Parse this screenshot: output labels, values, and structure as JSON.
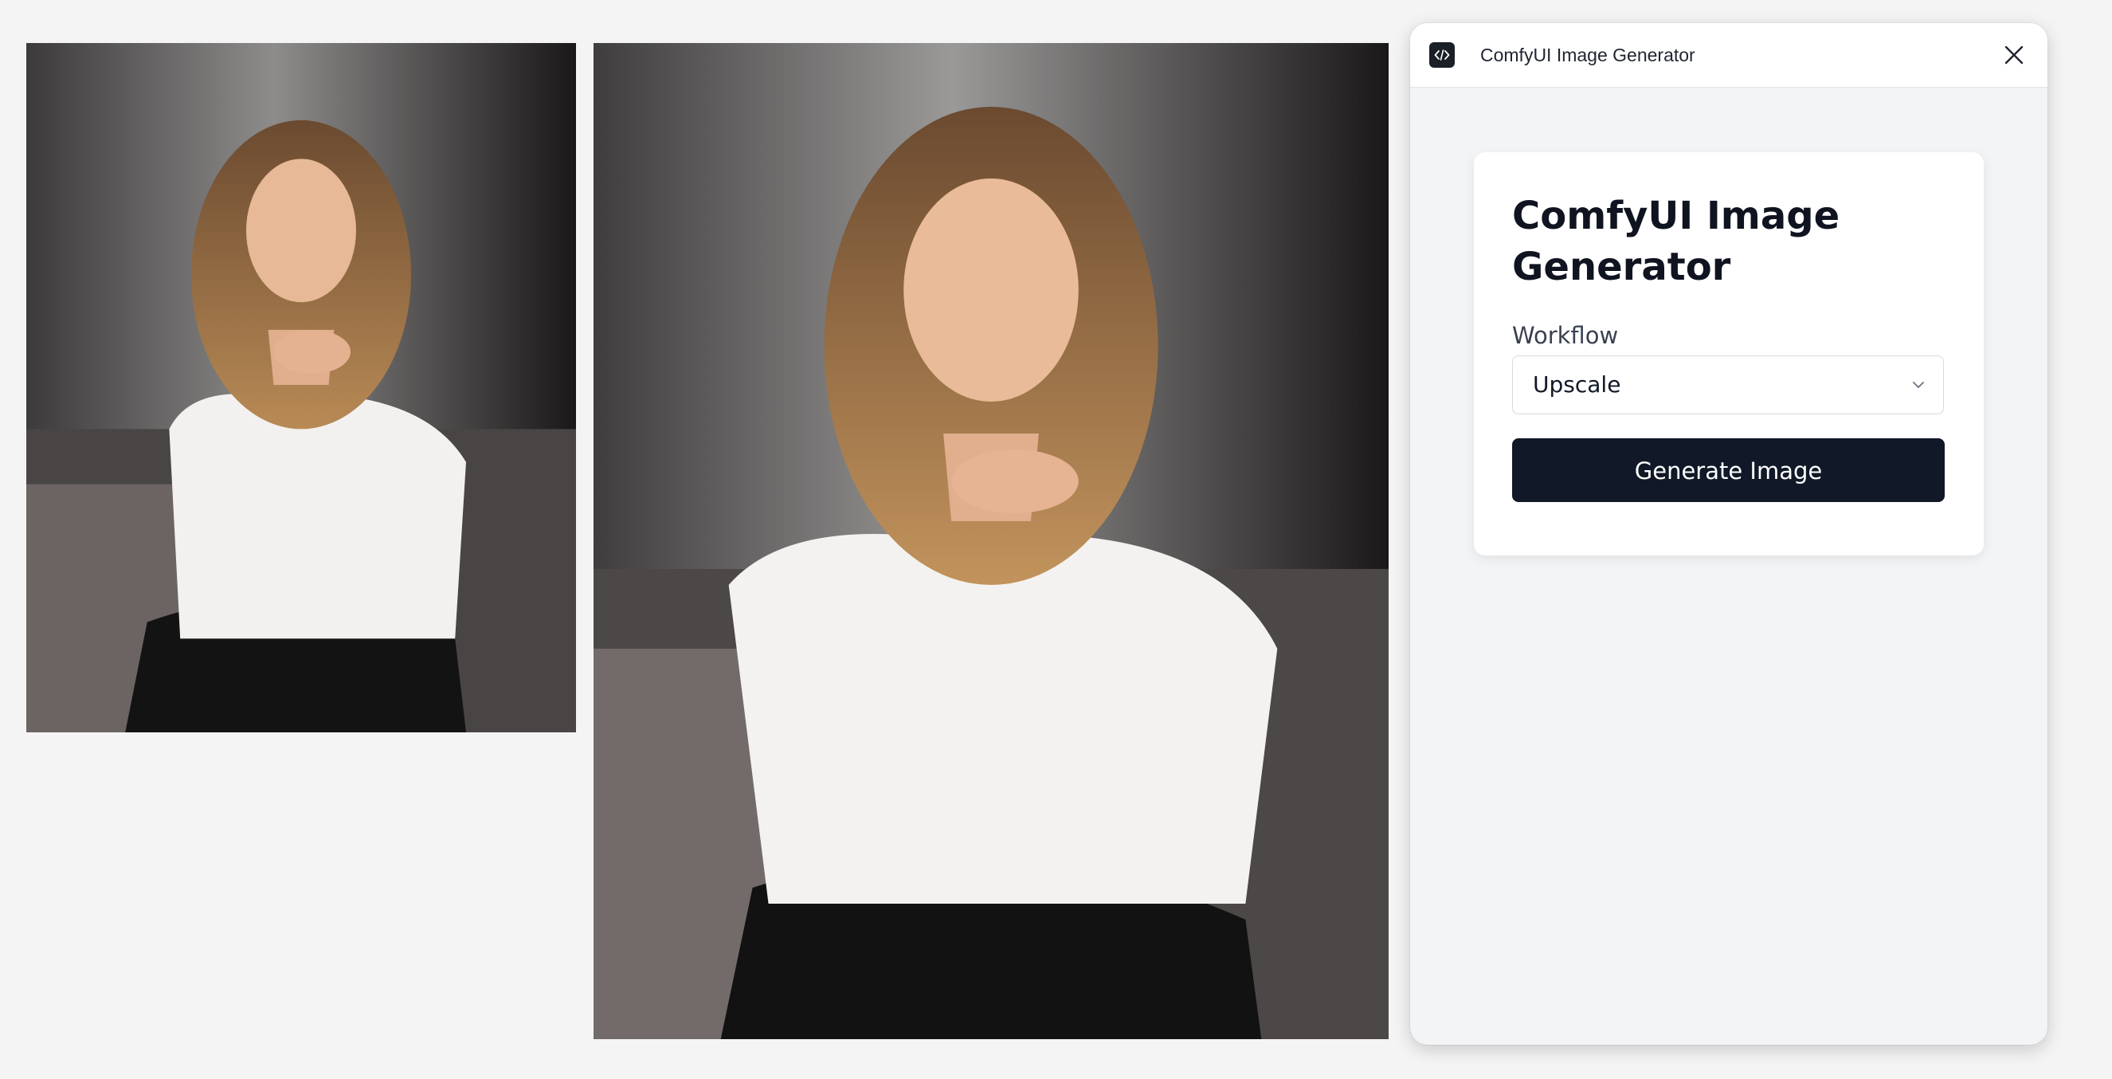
{
  "images": [
    {
      "name": "original-photo"
    },
    {
      "name": "upscaled-photo"
    }
  ],
  "panel": {
    "header_title": "ComfyUI Image Generator",
    "header_icon": "code-icon",
    "close_icon": "close-icon"
  },
  "card": {
    "title": "ComfyUI Image Generator",
    "workflow_label": "Workflow",
    "workflow_selected": "Upscale",
    "generate_label": "Generate Image"
  },
  "colors": {
    "page_bg": "#f4f4f4",
    "panel_bg": "#f3f4f6",
    "button_bg": "#111827",
    "button_text": "#ffffff"
  }
}
